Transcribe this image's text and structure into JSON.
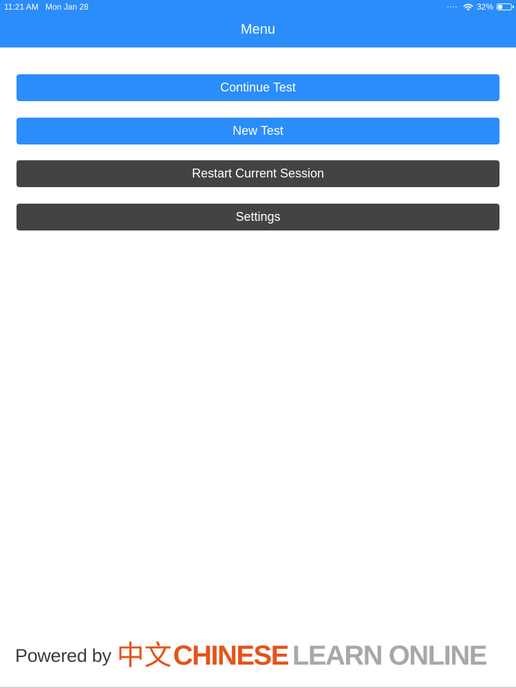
{
  "status_bar": {
    "time": "11:21 AM",
    "date": "Mon Jan 28",
    "battery_percent_label": "32%",
    "battery_level": 0.32
  },
  "nav": {
    "title": "Menu"
  },
  "menu": {
    "items": [
      {
        "label": "Continue Test",
        "style": "primary"
      },
      {
        "label": "New Test",
        "style": "primary"
      },
      {
        "label": "Restart Current Session",
        "style": "secondary"
      },
      {
        "label": "Settings",
        "style": "secondary"
      }
    ]
  },
  "footer": {
    "powered_by": "Powered by",
    "logo_chinese_chars": "中文",
    "logo_word_1": "CHINESE",
    "logo_word_2": "LEARN ONLINE"
  },
  "colors": {
    "primary": "#2B8DFA",
    "secondary": "#434244",
    "logo_orange": "#E5531A",
    "logo_gray": "#A8A8A8"
  },
  "icons": {
    "wifi": "wifi-icon",
    "battery": "battery-icon",
    "signal": "signal-dots-icon"
  }
}
